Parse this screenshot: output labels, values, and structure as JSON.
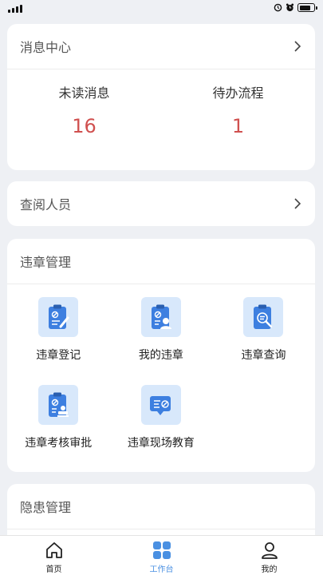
{
  "status_bar": {
    "icons": [
      "alarm-icon",
      "clock-icon",
      "battery-icon"
    ]
  },
  "message_center": {
    "title": "消息中心",
    "stats": [
      {
        "label": "未读消息",
        "value": "16"
      },
      {
        "label": "待办流程",
        "value": "1"
      }
    ]
  },
  "viewers": {
    "title": "查阅人员"
  },
  "violation": {
    "title": "违章管理",
    "items": [
      {
        "label": "违章登记",
        "icon": "violation-register-icon"
      },
      {
        "label": "我的违章",
        "icon": "my-violation-icon"
      },
      {
        "label": "违章查询",
        "icon": "violation-search-icon"
      },
      {
        "label": "违章考核审批",
        "icon": "violation-approval-icon"
      },
      {
        "label": "违章现场教育",
        "icon": "violation-education-icon"
      }
    ]
  },
  "hazard": {
    "title": "隐患管理"
  },
  "tabbar": {
    "tabs": [
      {
        "label": "首页",
        "icon": "home-icon",
        "active": false
      },
      {
        "label": "工作台",
        "icon": "workbench-icon",
        "active": true
      },
      {
        "label": "我的",
        "icon": "profile-icon",
        "active": false
      }
    ]
  },
  "colors": {
    "accent": "#4a90e2",
    "count": "#d0504f",
    "icon_bg": "#d8e8fb",
    "background": "#eef0f4"
  }
}
